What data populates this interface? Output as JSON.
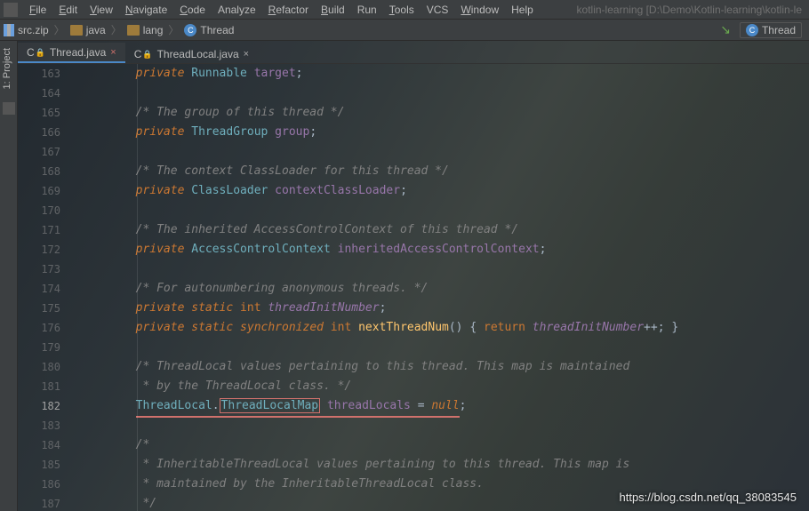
{
  "menu": {
    "items": [
      "File",
      "Edit",
      "View",
      "Navigate",
      "Code",
      "Analyze",
      "Refactor",
      "Build",
      "Run",
      "Tools",
      "VCS",
      "Window",
      "Help"
    ],
    "underline_idx": [
      0,
      0,
      0,
      0,
      0,
      -1,
      0,
      0,
      -1,
      0,
      -1,
      0,
      -1
    ],
    "project_label": "kotlin-learning [D:\\Demo\\Kotlin-learning\\kotlin-le"
  },
  "breadcrumb": {
    "items": [
      {
        "icon": "zip",
        "label": "src.zip"
      },
      {
        "icon": "folder",
        "label": "java"
      },
      {
        "icon": "folder",
        "label": "lang"
      },
      {
        "icon": "class",
        "label": "Thread"
      }
    ],
    "right_button": "Thread"
  },
  "sidebar": {
    "tab_label": "1: Project"
  },
  "tabs": [
    {
      "icon": "class",
      "label": "Thread.java",
      "locked": true,
      "dirty": true,
      "active": true
    },
    {
      "icon": "class",
      "label": "ThreadLocal.java",
      "locked": true,
      "dirty": false,
      "active": false
    }
  ],
  "lines_start": 163,
  "code": [
    {
      "n": 163,
      "tokens": [
        [
          "pad",
          ""
        ],
        [
          "kw",
          "private"
        ],
        [
          "op",
          " "
        ],
        [
          "type",
          "Runnable"
        ],
        [
          "op",
          " "
        ],
        [
          "fld",
          "target"
        ],
        [
          "op",
          ";"
        ]
      ]
    },
    {
      "n": 164,
      "tokens": []
    },
    {
      "n": 165,
      "tokens": [
        [
          "pad",
          ""
        ],
        [
          "cmt",
          "/* The group of this thread */"
        ]
      ]
    },
    {
      "n": 166,
      "tokens": [
        [
          "pad",
          ""
        ],
        [
          "kw",
          "private"
        ],
        [
          "op",
          " "
        ],
        [
          "type",
          "ThreadGroup"
        ],
        [
          "op",
          " "
        ],
        [
          "fld",
          "group"
        ],
        [
          "op",
          ";"
        ]
      ]
    },
    {
      "n": 167,
      "tokens": []
    },
    {
      "n": 168,
      "tokens": [
        [
          "pad",
          ""
        ],
        [
          "cmt",
          "/* The context ClassLoader for this thread */"
        ]
      ]
    },
    {
      "n": 169,
      "tokens": [
        [
          "pad",
          ""
        ],
        [
          "kw",
          "private"
        ],
        [
          "op",
          " "
        ],
        [
          "type",
          "ClassLoader"
        ],
        [
          "op",
          " "
        ],
        [
          "fld",
          "contextClassLoader"
        ],
        [
          "op",
          ";"
        ]
      ]
    },
    {
      "n": 170,
      "tokens": []
    },
    {
      "n": 171,
      "tokens": [
        [
          "pad",
          ""
        ],
        [
          "cmt",
          "/* The inherited AccessControlContext of this thread */"
        ]
      ]
    },
    {
      "n": 172,
      "tokens": [
        [
          "pad",
          ""
        ],
        [
          "kw",
          "private"
        ],
        [
          "op",
          " "
        ],
        [
          "type",
          "AccessControlContext"
        ],
        [
          "op",
          " "
        ],
        [
          "fld",
          "inheritedAccessControlContext"
        ],
        [
          "op",
          ";"
        ]
      ]
    },
    {
      "n": 173,
      "tokens": []
    },
    {
      "n": 174,
      "tokens": [
        [
          "pad",
          ""
        ],
        [
          "cmt",
          "/* For autonumbering anonymous threads. */"
        ]
      ]
    },
    {
      "n": 175,
      "tokens": [
        [
          "pad",
          ""
        ],
        [
          "kw",
          "private"
        ],
        [
          "op",
          " "
        ],
        [
          "kw",
          "static"
        ],
        [
          "op",
          " "
        ],
        [
          "kw2",
          "int"
        ],
        [
          "op",
          " "
        ],
        [
          "fldi",
          "threadInitNumber"
        ],
        [
          "op",
          ";"
        ]
      ]
    },
    {
      "n": 176,
      "tokens": [
        [
          "pad",
          ""
        ],
        [
          "kw",
          "private"
        ],
        [
          "op",
          " "
        ],
        [
          "kw",
          "static"
        ],
        [
          "op",
          " "
        ],
        [
          "kw",
          "synchronized"
        ],
        [
          "op",
          " "
        ],
        [
          "kw2",
          "int"
        ],
        [
          "op",
          " "
        ],
        [
          "fn",
          "nextThreadNum"
        ],
        [
          "op",
          "() { "
        ],
        [
          "kw2",
          "return"
        ],
        [
          "op",
          " "
        ],
        [
          "fldi",
          "threadInitNumber"
        ],
        [
          "op",
          "++"
        ],
        [
          "op",
          "; }"
        ]
      ]
    },
    {
      "n": 179,
      "tokens": []
    },
    {
      "n": 180,
      "tokens": [
        [
          "pad",
          ""
        ],
        [
          "cmt",
          "/* ThreadLocal values pertaining to this thread. This map is maintained"
        ]
      ]
    },
    {
      "n": 181,
      "tokens": [
        [
          "pad",
          ""
        ],
        [
          "cmt",
          " * by the ThreadLocal class. */"
        ]
      ]
    },
    {
      "n": 182,
      "hl": true,
      "tokens": [
        [
          "pad",
          ""
        ],
        [
          "ulstart",
          ""
        ],
        [
          "type",
          "ThreadLocal"
        ],
        [
          "op",
          "."
        ],
        [
          "boxtype",
          "ThreadLocalMap"
        ],
        [
          "op",
          " "
        ],
        [
          "fld",
          "threadLocals"
        ],
        [
          "op",
          " = "
        ],
        [
          "nul",
          "null"
        ],
        [
          "ulend",
          ""
        ],
        [
          "op",
          ";"
        ]
      ]
    },
    {
      "n": 183,
      "tokens": []
    },
    {
      "n": 184,
      "tokens": [
        [
          "pad",
          ""
        ],
        [
          "cmt",
          "/*"
        ]
      ]
    },
    {
      "n": 185,
      "tokens": [
        [
          "pad",
          ""
        ],
        [
          "cmt",
          " * InheritableThreadLocal values pertaining to this thread. This map is"
        ]
      ]
    },
    {
      "n": 186,
      "tokens": [
        [
          "pad",
          ""
        ],
        [
          "cmt",
          " * maintained by the InheritableThreadLocal class."
        ]
      ]
    },
    {
      "n": 187,
      "tokens": [
        [
          "pad",
          ""
        ],
        [
          "cmt",
          " */"
        ]
      ]
    }
  ],
  "watermark": "https://blog.csdn.net/qq_38083545"
}
